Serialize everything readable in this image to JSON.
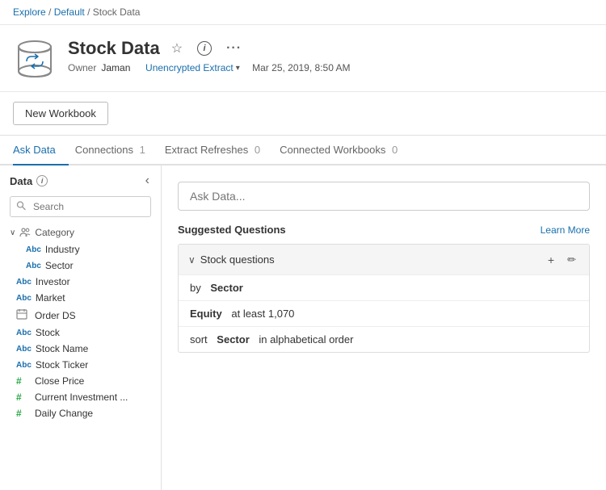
{
  "breadcrumb": {
    "explore": "Explore",
    "default": "Default",
    "current": "Stock Data",
    "sep": "/"
  },
  "header": {
    "title": "Stock Data",
    "owner_label": "Owner",
    "owner_name": "Jaman",
    "extract_label": "Unencrypted Extract",
    "date": "Mar 25, 2019, 8:50 AM",
    "star_icon": "☆",
    "info_icon": "ⓘ",
    "more_icon": "•••",
    "dropdown_arrow": "▼"
  },
  "actions": {
    "new_workbook": "New Workbook"
  },
  "tabs": [
    {
      "label": "Ask Data",
      "active": true,
      "count": null
    },
    {
      "label": "Connections",
      "active": false,
      "count": "1"
    },
    {
      "label": "Extract Refreshes",
      "active": false,
      "count": "0"
    },
    {
      "label": "Connected Workbooks",
      "active": false,
      "count": "0"
    }
  ],
  "left_panel": {
    "title": "Data",
    "collapse_icon": "‹",
    "search_placeholder": "Search",
    "category": {
      "label": "Category",
      "chevron": "∨"
    },
    "fields": [
      {
        "type": "abc",
        "name": "Industry",
        "indent": true
      },
      {
        "type": "abc",
        "name": "Sector",
        "indent": true
      },
      {
        "type": "abc",
        "name": "Investor",
        "indent": false
      },
      {
        "type": "abc",
        "name": "Market",
        "indent": false
      },
      {
        "type": "calendar",
        "name": "Order DS",
        "indent": false
      },
      {
        "type": "abc",
        "name": "Stock",
        "indent": false
      },
      {
        "type": "abc",
        "name": "Stock Name",
        "indent": false
      },
      {
        "type": "abc",
        "name": "Stock Ticker",
        "indent": false
      },
      {
        "type": "hash",
        "name": "Close Price",
        "indent": false
      },
      {
        "type": "hash",
        "name": "Current Investment ...",
        "indent": false
      },
      {
        "type": "hash",
        "name": "Daily Change",
        "indent": false
      }
    ]
  },
  "right_panel": {
    "ask_placeholder": "Ask Data...",
    "suggested_title": "Suggested Questions",
    "learn_more": "Learn More",
    "group": {
      "label": "Stock questions",
      "chevron": "∨",
      "plus_icon": "+",
      "edit_icon": "✏"
    },
    "questions": [
      {
        "prefix": "by",
        "bold": "Sector",
        "suffix": ""
      },
      {
        "prefix": "",
        "bold": "Equity",
        "suffix": "at least 1,070"
      },
      {
        "prefix": "sort",
        "bold": "Sector",
        "suffix": "in alphabetical order"
      }
    ]
  }
}
